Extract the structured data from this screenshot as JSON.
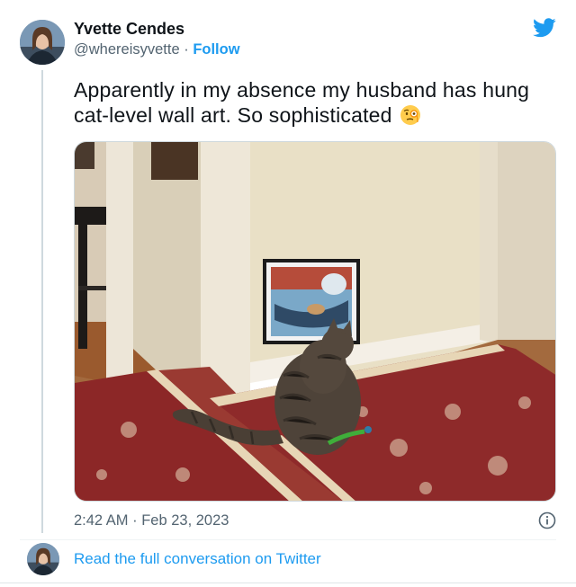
{
  "tweet": {
    "author_name": "Yvette Cendes",
    "handle": "@whereisyvette",
    "separator": " · ",
    "follow_label": "Follow",
    "text": "Apparently in my absence my husband has hung cat-level wall art. So sophisticated",
    "emoji": "face-with-monocle",
    "time": "2:42 AM",
    "date": "Feb 23, 2023",
    "read_link": "Read the full conversation on Twitter"
  },
  "icons": {
    "brand": "twitter-bird-icon",
    "info": "info-icon"
  },
  "colors": {
    "accent": "#1d9bf0",
    "text": "#0f1419",
    "muted": "#536471",
    "rug": "#8e2a2a",
    "wall": "#ece3cc",
    "floor": "#a0643a"
  }
}
